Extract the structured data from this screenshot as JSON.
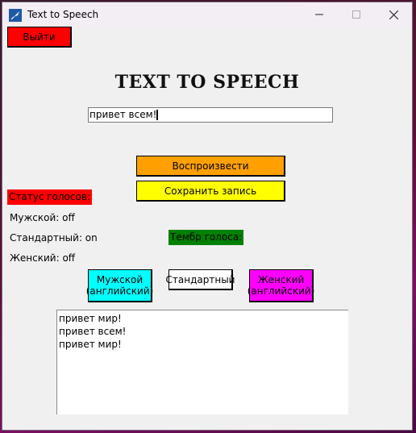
{
  "window": {
    "title": "Text to Speech",
    "minimize_icon": "minimize-icon",
    "maximize_icon": "maximize-icon",
    "close_icon": "close-icon"
  },
  "toolbar": {
    "exit_label": "Выйти"
  },
  "heading": "TEXT TO SPEECH",
  "input": {
    "value": "привет всем!"
  },
  "buttons": {
    "play_label": "Воспроизвести",
    "save_label": "Сохранить запись",
    "male_label_1": "Мужской",
    "male_label_2": "(английский)",
    "standard_label": "Стандартный",
    "female_label_1": "Женский",
    "female_label_2": "(английский)"
  },
  "status": {
    "label": "Статус голосов:",
    "male": "Мужской: off",
    "standard": "Стандартный: on",
    "female": "Женский: off"
  },
  "timbre_label": "Тембр голоса:",
  "log": [
    "привет мир!",
    "привет всем!",
    "привет мир!"
  ],
  "colors": {
    "exit": "#ff0000",
    "play": "#ffa000",
    "save": "#ffff00",
    "status": "#ff0000",
    "timbre": "#008000",
    "male": "#00ffff",
    "standard": "#ffffff",
    "female": "#ff00ff"
  }
}
